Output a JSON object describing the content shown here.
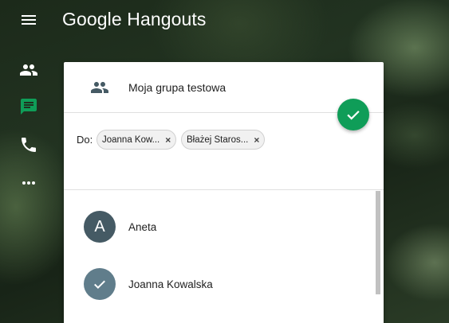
{
  "app": {
    "title": "Google Hangouts"
  },
  "rail": {
    "items": [
      {
        "icon": "people-icon",
        "active": false
      },
      {
        "icon": "message-icon",
        "active": true
      },
      {
        "icon": "phone-icon",
        "active": false
      },
      {
        "icon": "more-horizontal-icon",
        "active": false
      }
    ],
    "active_color": "#0f9d58"
  },
  "panel": {
    "group_name": "Moja grupa testowa",
    "to_label": "Do:",
    "recipients": [
      {
        "label": "Joanna Kow...",
        "remove": "×"
      },
      {
        "label": "Błażej Staros...",
        "remove": "×"
      }
    ],
    "contacts": [
      {
        "initial": "A",
        "name": "Aneta",
        "selected": false,
        "avatar_color": "#455a64"
      },
      {
        "initial": "",
        "name": "Joanna Kowalska",
        "selected": true,
        "avatar_color": "#607d8b"
      }
    ]
  }
}
